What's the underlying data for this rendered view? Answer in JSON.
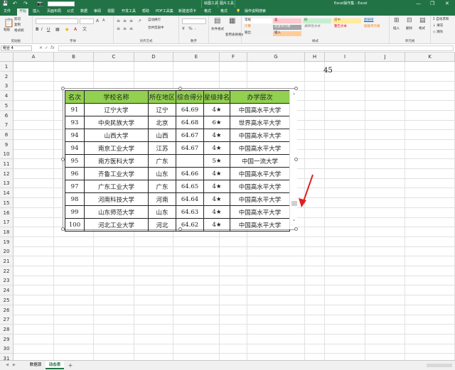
{
  "titlebar": {
    "quick_access": [
      "💾",
      "↶",
      "↷",
      "📷"
    ],
    "ctx_groups": [
      "绘图工具",
      "图片工具"
    ],
    "title": "Excel操作集 - Excel",
    "window_buttons": [
      "—",
      "❐",
      "✕"
    ]
  },
  "tabs": [
    "文件",
    "开始",
    "插入",
    "页面布局",
    "公式",
    "数据",
    "审阅",
    "视图",
    "开发工具",
    "帮助",
    "PDF工具集",
    "新建选项卡",
    "格式",
    "格式",
    "操作说明搜索"
  ],
  "ribbon": {
    "clipboard": {
      "paste": "粘贴",
      "cut": "剪切",
      "copy": "复制",
      "painter": "格式刷",
      "label": "剪贴板"
    },
    "font": {
      "label": "字体"
    },
    "align": {
      "label": "对齐方式",
      "wrap": "自动换行",
      "merge": "合并后居中"
    },
    "number": {
      "label": "数字"
    },
    "cond": {
      "conditional": "条件格式",
      "table": "套用表格格式"
    },
    "styles": {
      "label": "样式",
      "cells": [
        "常规",
        "差",
        "好",
        "适中",
        "超链接",
        "计算",
        "检查单元格",
        "解释性文本",
        "警告文本",
        "链接单元格",
        "输出",
        "输入"
      ]
    },
    "cells": {
      "insert": "插入",
      "delete": "删除",
      "format": "格式",
      "label": "单元格"
    },
    "editing": {
      "autosum": "自动求和",
      "fill": "填充",
      "clear": "清除"
    }
  },
  "formula_bar": {
    "namebox": "组合 4",
    "fx": "fx",
    "cancel": "✕",
    "enter": "✓"
  },
  "columns": [
    "A",
    "B",
    "C",
    "D",
    "E",
    "F",
    "G",
    "H",
    "I",
    "J",
    "K"
  ],
  "rows": [
    "1",
    "2",
    "3",
    "4",
    "5",
    "6",
    "7",
    "8",
    "9",
    "10",
    "11",
    "12",
    "13",
    "14",
    "15",
    "16",
    "17",
    "18",
    "19",
    "20",
    "21",
    "22",
    "23",
    "24",
    "25",
    "26",
    "27",
    "28",
    "29",
    "30",
    "31"
  ],
  "cell_h1": "45",
  "table": {
    "headers": [
      "名次",
      "学校名称",
      "所在地区",
      "综合得分",
      "星级排名",
      "办学层次"
    ],
    "rows": [
      [
        "91",
        "辽宁大学",
        "辽宁",
        "64.69",
        "4★",
        "中国高水平大学"
      ],
      [
        "93",
        "中央民族大学",
        "北京",
        "64.68",
        "6★",
        "世界高水平大学"
      ],
      [
        "94",
        "山西大学",
        "山西",
        "64.67",
        "4★",
        "中国高水平大学"
      ],
      [
        "94",
        "南京工业大学",
        "江苏",
        "64.67",
        "4★",
        "中国高水平大学"
      ],
      [
        "95",
        "南方医科大学",
        "广东",
        "",
        "5★",
        "中国一流大学"
      ],
      [
        "96",
        "齐鲁工业大学",
        "山东",
        "64.66",
        "4★",
        "中国高水平大学"
      ],
      [
        "97",
        "广东工业大学",
        "广东",
        "64.65",
        "4★",
        "中国高水平大学"
      ],
      [
        "98",
        "河南科技大学",
        "河南",
        "64.64",
        "4★",
        "中国高水平大学"
      ],
      [
        "99",
        "山东师范大学",
        "山东",
        "64.63",
        "4★",
        "中国高水平大学"
      ],
      [
        "100",
        "河北工业大学",
        "河北",
        "64.62",
        "4★",
        "中国高水平大学"
      ]
    ]
  },
  "sheets": [
    "数据源",
    "动态表"
  ],
  "add_sheet": "+",
  "colors": {
    "excel_green": "#217346",
    "header_green": "#92d050",
    "arrow": "#e02020"
  }
}
